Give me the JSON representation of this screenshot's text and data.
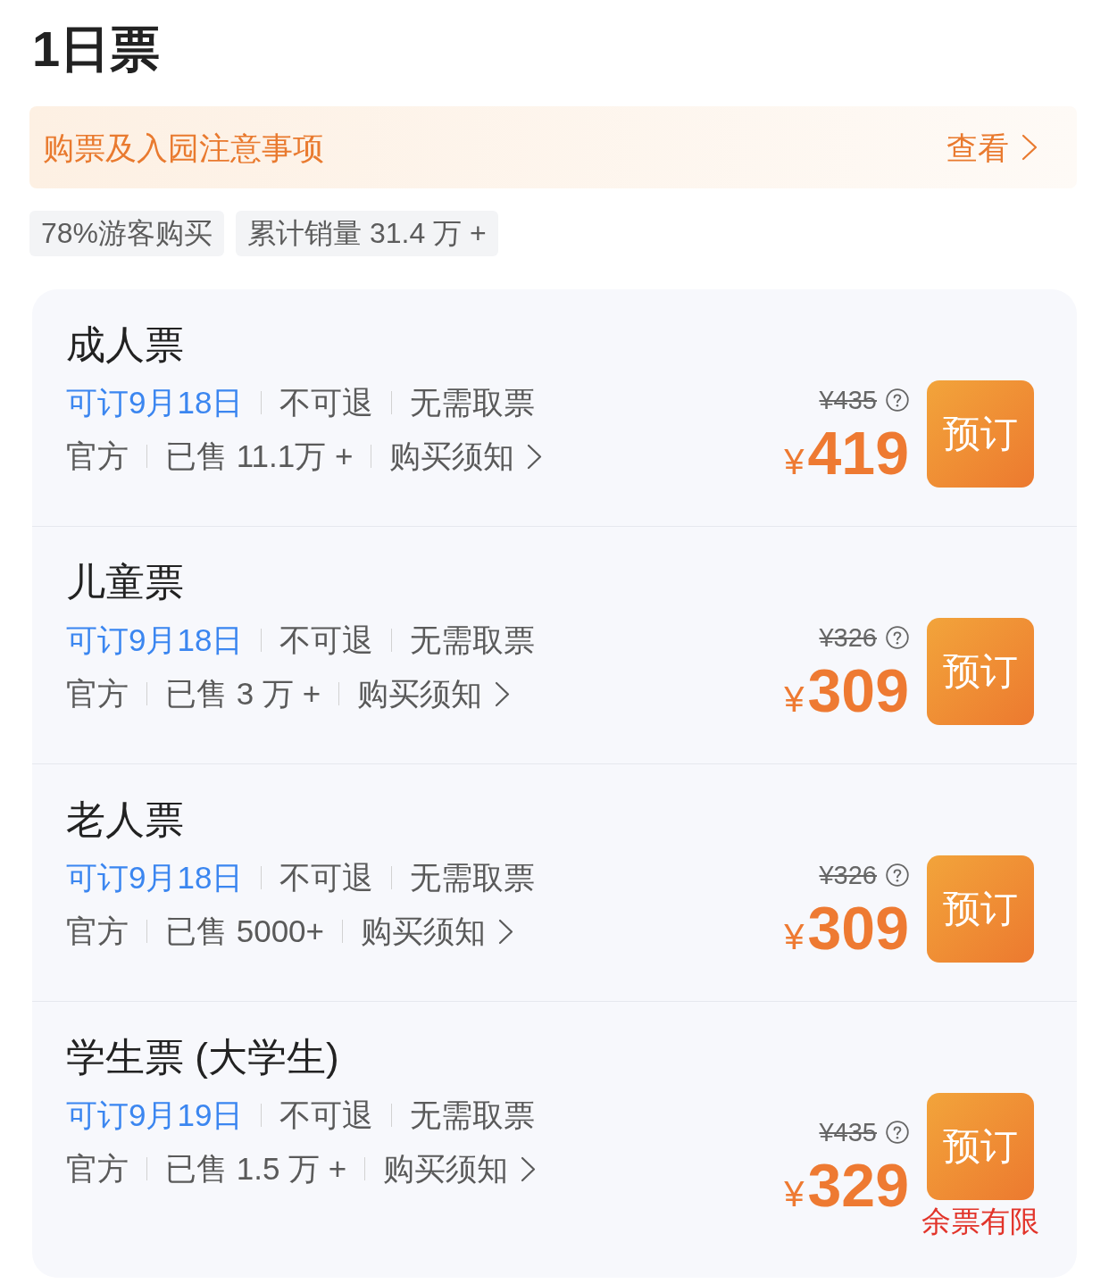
{
  "title": "1日票",
  "notice": {
    "text": "购票及入园注意事项",
    "action": "查看"
  },
  "tags": [
    "78%游客购买",
    "累计销量 31.4 万 +"
  ],
  "tickets": [
    {
      "name": "成人票",
      "date": "可订9月18日",
      "refund": "不可退",
      "pickup": "无需取票",
      "source": "官方",
      "sold": "已售 11.1万 +",
      "notice_link": "购买须知",
      "original_price": "¥435",
      "currency": "¥",
      "price": "419",
      "button": "预订"
    },
    {
      "name": "儿童票",
      "date": "可订9月18日",
      "refund": "不可退",
      "pickup": "无需取票",
      "source": "官方",
      "sold": "已售 3 万 +",
      "notice_link": "购买须知",
      "original_price": "¥326",
      "currency": "¥",
      "price": "309",
      "button": "预订"
    },
    {
      "name": "老人票",
      "date": "可订9月18日",
      "refund": "不可退",
      "pickup": "无需取票",
      "source": "官方",
      "sold": "已售 5000+",
      "notice_link": "购买须知",
      "original_price": "¥326",
      "currency": "¥",
      "price": "309",
      "button": "预订"
    },
    {
      "name": "学生票 (大学生)",
      "date": "可订9月19日",
      "refund": "不可退",
      "pickup": "无需取票",
      "source": "官方",
      "sold": "已售 1.5 万 +",
      "notice_link": "购买须知",
      "original_price": "¥435",
      "currency": "¥",
      "price": "329",
      "button": "预订",
      "stock_note": "余票有限"
    }
  ]
}
